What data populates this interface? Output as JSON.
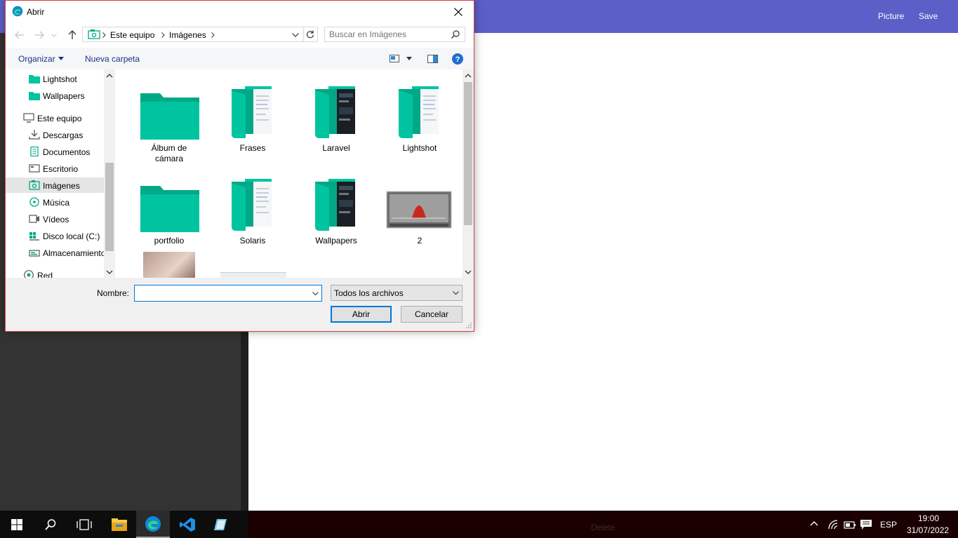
{
  "app": {
    "nav": {
      "picture": "Picture",
      "save": "Save"
    },
    "bottom_text": "Delete"
  },
  "dialog": {
    "title": "Abrir",
    "address": {
      "crumbs": [
        "Este equipo",
        "Imágenes"
      ]
    },
    "search_placeholder": "Buscar en Imágenes",
    "toolbar": {
      "organize": "Organizar",
      "new_folder": "Nueva carpeta"
    },
    "nav_items": [
      {
        "label": "Lightshot",
        "icon": "folder-icon"
      },
      {
        "label": "Wallpapers",
        "icon": "folder-icon"
      },
      {
        "label": "Este equipo",
        "icon": "computer-icon"
      },
      {
        "label": "Descargas",
        "icon": "download-icon"
      },
      {
        "label": "Documentos",
        "icon": "document-icon"
      },
      {
        "label": "Escritorio",
        "icon": "desktop-icon"
      },
      {
        "label": "Imágenes",
        "icon": "pictures-icon",
        "selected": true
      },
      {
        "label": "Música",
        "icon": "music-icon"
      },
      {
        "label": "Vídeos",
        "icon": "video-icon"
      },
      {
        "label": "Disco local (C:)",
        "icon": "drive-icon"
      },
      {
        "label": "Almacenamiento",
        "icon": "storage-icon"
      },
      {
        "label": "Red",
        "icon": "network-icon"
      }
    ],
    "files": [
      {
        "label": "Álbum de cámara",
        "type": "folder"
      },
      {
        "label": "Frases",
        "type": "folder-docs"
      },
      {
        "label": "Laravel",
        "type": "folder-dark"
      },
      {
        "label": "Lightshot",
        "type": "folder-docs"
      },
      {
        "label": "portfolio",
        "type": "folder"
      },
      {
        "label": "Solaris",
        "type": "folder-docs"
      },
      {
        "label": "Wallpapers",
        "type": "folder-dark"
      },
      {
        "label": "2",
        "type": "image"
      }
    ],
    "name_label": "Nombre:",
    "name_value": "",
    "filetype": "Todos los archivos",
    "open_button": "Abrir",
    "cancel_button": "Cancelar"
  },
  "tray": {
    "language": "ESP",
    "time": "19:00",
    "date": "31/07/2022"
  },
  "colors": {
    "accent": "#5b5fc7",
    "folder": "#00c4a0",
    "folder_dark": "#00a887",
    "focus": "#0078d7"
  }
}
